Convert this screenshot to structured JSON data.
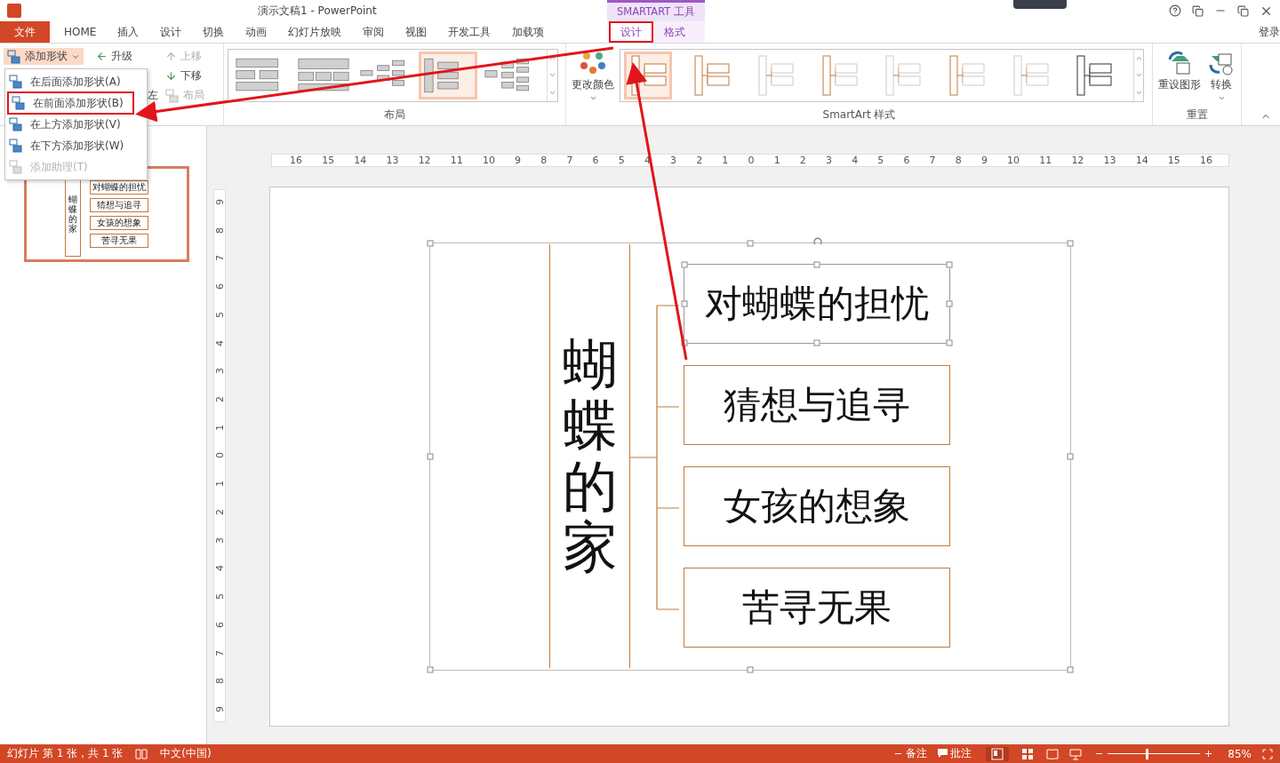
{
  "window": {
    "title": "演示文稿1 - PowerPoint",
    "context_label": "SMARTART 工具",
    "sign_in": "登录"
  },
  "tabs": [
    {
      "label": "文件",
      "kind": "file",
      "selected": false,
      "highlighted": false
    },
    {
      "label": "HOME",
      "kind": "main",
      "selected": false,
      "highlighted": false
    },
    {
      "label": "插入",
      "kind": "main",
      "selected": false,
      "highlighted": false
    },
    {
      "label": "设计",
      "kind": "main",
      "selected": false,
      "highlighted": false
    },
    {
      "label": "切换",
      "kind": "main",
      "selected": false,
      "highlighted": false
    },
    {
      "label": "动画",
      "kind": "main",
      "selected": false,
      "highlighted": false
    },
    {
      "label": "幻灯片放映",
      "kind": "main",
      "selected": false,
      "highlighted": false
    },
    {
      "label": "审阅",
      "kind": "main",
      "selected": false,
      "highlighted": false
    },
    {
      "label": "视图",
      "kind": "main",
      "selected": false,
      "highlighted": false
    },
    {
      "label": "开发工具",
      "kind": "main",
      "selected": false,
      "highlighted": false
    },
    {
      "label": "加载项",
      "kind": "main",
      "selected": false,
      "highlighted": false
    },
    {
      "label": "设计",
      "kind": "context",
      "selected": true,
      "highlighted": true
    },
    {
      "label": "格式",
      "kind": "context",
      "selected": false,
      "highlighted": false
    }
  ],
  "ribbon": {
    "create": {
      "add_shape": "添加形状",
      "promote": "升级",
      "move_up": "上移",
      "move_down": "下移",
      "right_to_left": "左",
      "layout": "布局"
    },
    "layouts": {
      "label": "布局",
      "items": [
        {
          "selected": false
        },
        {
          "selected": false
        },
        {
          "selected": false
        },
        {
          "selected": true
        },
        {
          "selected": false
        }
      ]
    },
    "change_colors": "更改颜色",
    "styles": {
      "label": "SmartArt 样式",
      "items": [
        {
          "selected": true
        },
        {
          "selected": false
        },
        {
          "selected": false
        },
        {
          "selected": false
        },
        {
          "selected": false
        },
        {
          "selected": false
        },
        {
          "selected": false
        },
        {
          "selected": false
        }
      ]
    },
    "reset": {
      "label": "重置",
      "reset_graphic": "重设图形",
      "convert": "转换"
    }
  },
  "dropdown": {
    "items": [
      {
        "label": "在后面添加形状(A)",
        "disabled": false,
        "highlighted": false
      },
      {
        "label": "在前面添加形状(B)",
        "disabled": false,
        "highlighted": true
      },
      {
        "label": "在上方添加形状(V)",
        "disabled": false,
        "highlighted": false
      },
      {
        "label": "在下方添加形状(W)",
        "disabled": false,
        "highlighted": false
      },
      {
        "label": "添加助理(T)",
        "disabled": true,
        "highlighted": false
      }
    ]
  },
  "thumbnail": {
    "selected": true,
    "title": "蝴蝶的家",
    "items": [
      "对蝴蝶的担忧",
      "猜想与追寻",
      "女孩的想象",
      "苦寻无果"
    ]
  },
  "rulers": {
    "horizontal": [
      "16",
      "15",
      "14",
      "13",
      "12",
      "11",
      "10",
      "9",
      "8",
      "7",
      "6",
      "5",
      "4",
      "3",
      "2",
      "1",
      "0",
      "1",
      "2",
      "3",
      "4",
      "5",
      "6",
      "7",
      "8",
      "9",
      "10",
      "11",
      "12",
      "13",
      "14",
      "15",
      "16"
    ],
    "vertical": [
      "9",
      "8",
      "7",
      "6",
      "5",
      "4",
      "3",
      "2",
      "1",
      "0",
      "1",
      "2",
      "3",
      "4",
      "5",
      "6",
      "7",
      "8",
      "9"
    ]
  },
  "slide": {
    "title": "蝴蝶的家",
    "items": [
      {
        "text": "对蝴蝶的担忧",
        "selected": true
      },
      {
        "text": "猜想与追寻",
        "selected": false
      },
      {
        "text": "女孩的想象",
        "selected": false
      },
      {
        "text": "苦寻无果",
        "selected": false
      }
    ]
  },
  "status_bar": {
    "slide_info": "幻灯片 第 1 张，共 1 张",
    "language": "中文(中国)",
    "notes": "备注",
    "comments": "批注",
    "zoom": {
      "level": 0.42
    },
    "zoom_text": "85%"
  }
}
